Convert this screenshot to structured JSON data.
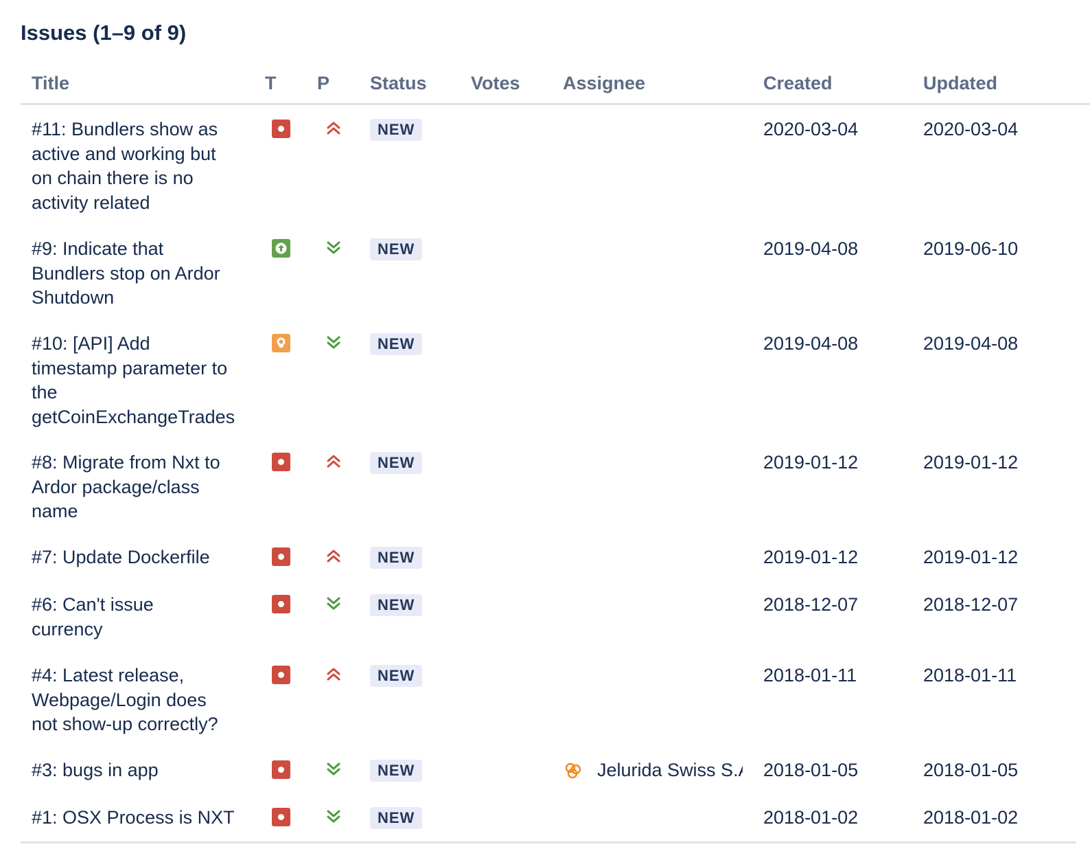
{
  "heading": "Issues (1–9 of 9)",
  "columns": {
    "title": "Title",
    "type": "T",
    "priority": "P",
    "status": "Status",
    "votes": "Votes",
    "assignee": "Assignee",
    "created": "Created",
    "updated": "Updated"
  },
  "colors": {
    "bug": "#cd4c3f",
    "enhancement": "#63a14a",
    "proposal": "#f0a04c",
    "priority_high": "#cd4c3f",
    "priority_low": "#4b9a3f",
    "badge_bg": "#e8eaf8"
  },
  "issues": [
    {
      "title_lines": [
        "#11: Bundlers show as",
        "active and working but",
        "on chain there is no",
        "activity related"
      ],
      "type": "bug-icon",
      "priority": "priority-high-icon",
      "status": "NEW",
      "votes": "",
      "assignee": "",
      "created": "2020-03-04",
      "updated": "2020-03-04"
    },
    {
      "title_lines": [
        "#9: Indicate that",
        "Bundlers stop on Ardor",
        "Shutdown"
      ],
      "type": "enhancement-icon",
      "priority": "priority-low-icon",
      "status": "NEW",
      "votes": "",
      "assignee": "",
      "created": "2019-04-08",
      "updated": "2019-06-10"
    },
    {
      "title_lines": [
        "#10: [API] Add",
        "timestamp parameter to",
        "the",
        "getCoinExchangeTrades"
      ],
      "type": "proposal-icon",
      "priority": "priority-low-icon",
      "status": "NEW",
      "votes": "",
      "assignee": "",
      "created": "2019-04-08",
      "updated": "2019-04-08"
    },
    {
      "title_lines": [
        "#8: Migrate from Nxt to",
        "Ardor package/class",
        "name"
      ],
      "type": "bug-icon",
      "priority": "priority-high-icon",
      "status": "NEW",
      "votes": "",
      "assignee": "",
      "created": "2019-01-12",
      "updated": "2019-01-12"
    },
    {
      "title_lines": [
        "#7: Update Dockerfile"
      ],
      "type": "bug-icon",
      "priority": "priority-high-icon",
      "status": "NEW",
      "votes": "",
      "assignee": "",
      "created": "2019-01-12",
      "updated": "2019-01-12"
    },
    {
      "title_lines": [
        "#6: Can't issue",
        "currency"
      ],
      "type": "bug-icon",
      "priority": "priority-low-icon",
      "status": "NEW",
      "votes": "",
      "assignee": "",
      "created": "2018-12-07",
      "updated": "2018-12-07"
    },
    {
      "title_lines": [
        "#4: Latest release,",
        "Webpage/Login does",
        "not show-up correctly?"
      ],
      "type": "bug-icon",
      "priority": "priority-high-icon",
      "status": "NEW",
      "votes": "",
      "assignee": "",
      "created": "2018-01-11",
      "updated": "2018-01-11"
    },
    {
      "title_lines": [
        "#3: bugs in app"
      ],
      "type": "bug-icon",
      "priority": "priority-low-icon",
      "status": "NEW",
      "votes": "",
      "assignee": "Jelurida Swiss S.A.",
      "created": "2018-01-05",
      "updated": "2018-01-05"
    },
    {
      "title_lines": [
        "#1: OSX Process is NXT"
      ],
      "type": "bug-icon",
      "priority": "priority-low-icon",
      "status": "NEW",
      "votes": "",
      "assignee": "",
      "created": "2018-01-02",
      "updated": "2018-01-02"
    }
  ]
}
